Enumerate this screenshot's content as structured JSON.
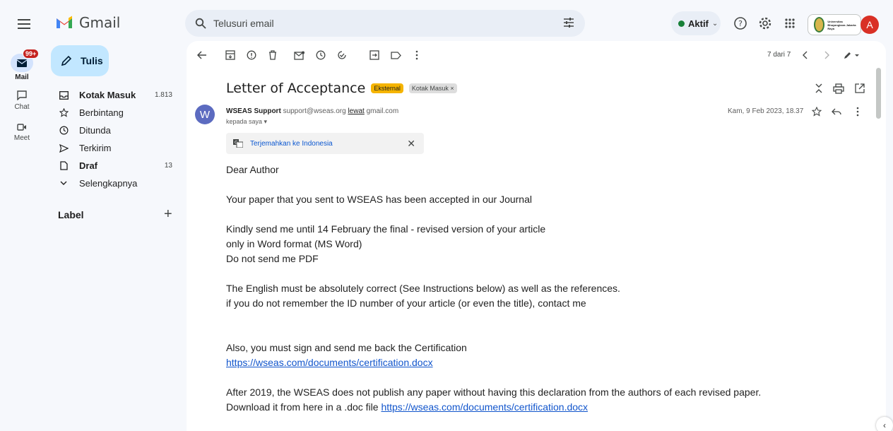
{
  "app": {
    "logo_text": "Gmail"
  },
  "search": {
    "placeholder": "Telusuri email"
  },
  "status": {
    "label": "Aktif"
  },
  "account": {
    "avatar_letter": "A",
    "org_text": "Universitas Bhayangkara Jakarta Raya"
  },
  "rail": {
    "mail": {
      "label": "Mail",
      "badge": "99+"
    },
    "chat": {
      "label": "Chat"
    },
    "meet": {
      "label": "Meet"
    }
  },
  "compose": {
    "label": "Tulis"
  },
  "nav": [
    {
      "label": "Kotak Masuk",
      "count": "1.813",
      "icon": "inbox-icon",
      "bold": true
    },
    {
      "label": "Berbintang",
      "count": "",
      "icon": "star-icon",
      "bold": false
    },
    {
      "label": "Ditunda",
      "count": "",
      "icon": "clock-icon",
      "bold": false
    },
    {
      "label": "Terkirim",
      "count": "",
      "icon": "send-icon",
      "bold": false
    },
    {
      "label": "Draf",
      "count": "13",
      "icon": "draft-icon",
      "bold": true
    },
    {
      "label": "Selengkapnya",
      "count": "",
      "icon": "chevron-down-icon",
      "bold": false
    }
  ],
  "labels": {
    "heading": "Label"
  },
  "pager": {
    "text": "7 dari 7"
  },
  "email": {
    "subject": "Letter of Acceptance",
    "chip_external": "Eksternal",
    "chip_inbox": "Kotak Masuk ×",
    "sender_initial": "W",
    "sender_name": "WSEAS Support",
    "sender_email": "support@wseas.org",
    "sender_via": "lewat",
    "sender_domain": "gmail.com",
    "recipient": "kepada saya ▾",
    "date": "Kam, 9 Feb 2023, 18.37",
    "translate_label": "Terjemahkan ke Indonesia",
    "body": {
      "greeting": "Dear Author",
      "p1": "Your paper that you sent to WSEAS has been accepted in our Journal",
      "p2_l1": "Kindly send me until 14 February the final - revised version of your article",
      "p2_l2": "only in Word format (MS Word)",
      "p2_l3": "Do not send me PDF",
      "p3_l1": "The English must be absolutely correct (See Instructions below) as well as the references.",
      "p3_l2": "if you do not remember the ID number of your article (or even the title), contact me",
      "p4_l1": "Also, you must sign and send me back the Certification",
      "p4_link": "https://wseas.com/documents/certification.docx",
      "p5_l1": "After 2019, the WSEAS does not publish any paper without having this declaration from the authors of each revised paper.",
      "p5_l2_text": "Download it from here in a .doc file ",
      "p5_link": "https://wseas.com/documents/certification.docx"
    }
  },
  "colors": {
    "accent": "#0b57d0",
    "compose_bg": "#c2e7ff",
    "external_chip": "#f5b400",
    "badge": "#c5221f"
  }
}
